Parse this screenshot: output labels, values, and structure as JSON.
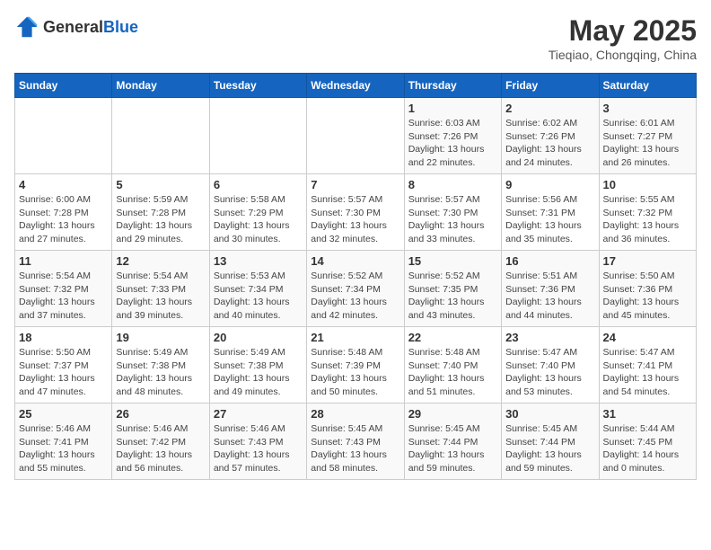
{
  "header": {
    "logo_general": "General",
    "logo_blue": "Blue",
    "month_year": "May 2025",
    "location": "Tieqiao, Chongqing, China"
  },
  "weekdays": [
    "Sunday",
    "Monday",
    "Tuesday",
    "Wednesday",
    "Thursday",
    "Friday",
    "Saturday"
  ],
  "weeks": [
    [
      {
        "day": "",
        "info": ""
      },
      {
        "day": "",
        "info": ""
      },
      {
        "day": "",
        "info": ""
      },
      {
        "day": "",
        "info": ""
      },
      {
        "day": "1",
        "info": "Sunrise: 6:03 AM\nSunset: 7:26 PM\nDaylight: 13 hours\nand 22 minutes."
      },
      {
        "day": "2",
        "info": "Sunrise: 6:02 AM\nSunset: 7:26 PM\nDaylight: 13 hours\nand 24 minutes."
      },
      {
        "day": "3",
        "info": "Sunrise: 6:01 AM\nSunset: 7:27 PM\nDaylight: 13 hours\nand 26 minutes."
      }
    ],
    [
      {
        "day": "4",
        "info": "Sunrise: 6:00 AM\nSunset: 7:28 PM\nDaylight: 13 hours\nand 27 minutes."
      },
      {
        "day": "5",
        "info": "Sunrise: 5:59 AM\nSunset: 7:28 PM\nDaylight: 13 hours\nand 29 minutes."
      },
      {
        "day": "6",
        "info": "Sunrise: 5:58 AM\nSunset: 7:29 PM\nDaylight: 13 hours\nand 30 minutes."
      },
      {
        "day": "7",
        "info": "Sunrise: 5:57 AM\nSunset: 7:30 PM\nDaylight: 13 hours\nand 32 minutes."
      },
      {
        "day": "8",
        "info": "Sunrise: 5:57 AM\nSunset: 7:30 PM\nDaylight: 13 hours\nand 33 minutes."
      },
      {
        "day": "9",
        "info": "Sunrise: 5:56 AM\nSunset: 7:31 PM\nDaylight: 13 hours\nand 35 minutes."
      },
      {
        "day": "10",
        "info": "Sunrise: 5:55 AM\nSunset: 7:32 PM\nDaylight: 13 hours\nand 36 minutes."
      }
    ],
    [
      {
        "day": "11",
        "info": "Sunrise: 5:54 AM\nSunset: 7:32 PM\nDaylight: 13 hours\nand 37 minutes."
      },
      {
        "day": "12",
        "info": "Sunrise: 5:54 AM\nSunset: 7:33 PM\nDaylight: 13 hours\nand 39 minutes."
      },
      {
        "day": "13",
        "info": "Sunrise: 5:53 AM\nSunset: 7:34 PM\nDaylight: 13 hours\nand 40 minutes."
      },
      {
        "day": "14",
        "info": "Sunrise: 5:52 AM\nSunset: 7:34 PM\nDaylight: 13 hours\nand 42 minutes."
      },
      {
        "day": "15",
        "info": "Sunrise: 5:52 AM\nSunset: 7:35 PM\nDaylight: 13 hours\nand 43 minutes."
      },
      {
        "day": "16",
        "info": "Sunrise: 5:51 AM\nSunset: 7:36 PM\nDaylight: 13 hours\nand 44 minutes."
      },
      {
        "day": "17",
        "info": "Sunrise: 5:50 AM\nSunset: 7:36 PM\nDaylight: 13 hours\nand 45 minutes."
      }
    ],
    [
      {
        "day": "18",
        "info": "Sunrise: 5:50 AM\nSunset: 7:37 PM\nDaylight: 13 hours\nand 47 minutes."
      },
      {
        "day": "19",
        "info": "Sunrise: 5:49 AM\nSunset: 7:38 PM\nDaylight: 13 hours\nand 48 minutes."
      },
      {
        "day": "20",
        "info": "Sunrise: 5:49 AM\nSunset: 7:38 PM\nDaylight: 13 hours\nand 49 minutes."
      },
      {
        "day": "21",
        "info": "Sunrise: 5:48 AM\nSunset: 7:39 PM\nDaylight: 13 hours\nand 50 minutes."
      },
      {
        "day": "22",
        "info": "Sunrise: 5:48 AM\nSunset: 7:40 PM\nDaylight: 13 hours\nand 51 minutes."
      },
      {
        "day": "23",
        "info": "Sunrise: 5:47 AM\nSunset: 7:40 PM\nDaylight: 13 hours\nand 53 minutes."
      },
      {
        "day": "24",
        "info": "Sunrise: 5:47 AM\nSunset: 7:41 PM\nDaylight: 13 hours\nand 54 minutes."
      }
    ],
    [
      {
        "day": "25",
        "info": "Sunrise: 5:46 AM\nSunset: 7:41 PM\nDaylight: 13 hours\nand 55 minutes."
      },
      {
        "day": "26",
        "info": "Sunrise: 5:46 AM\nSunset: 7:42 PM\nDaylight: 13 hours\nand 56 minutes."
      },
      {
        "day": "27",
        "info": "Sunrise: 5:46 AM\nSunset: 7:43 PM\nDaylight: 13 hours\nand 57 minutes."
      },
      {
        "day": "28",
        "info": "Sunrise: 5:45 AM\nSunset: 7:43 PM\nDaylight: 13 hours\nand 58 minutes."
      },
      {
        "day": "29",
        "info": "Sunrise: 5:45 AM\nSunset: 7:44 PM\nDaylight: 13 hours\nand 59 minutes."
      },
      {
        "day": "30",
        "info": "Sunrise: 5:45 AM\nSunset: 7:44 PM\nDaylight: 13 hours\nand 59 minutes."
      },
      {
        "day": "31",
        "info": "Sunrise: 5:44 AM\nSunset: 7:45 PM\nDaylight: 14 hours\nand 0 minutes."
      }
    ]
  ]
}
